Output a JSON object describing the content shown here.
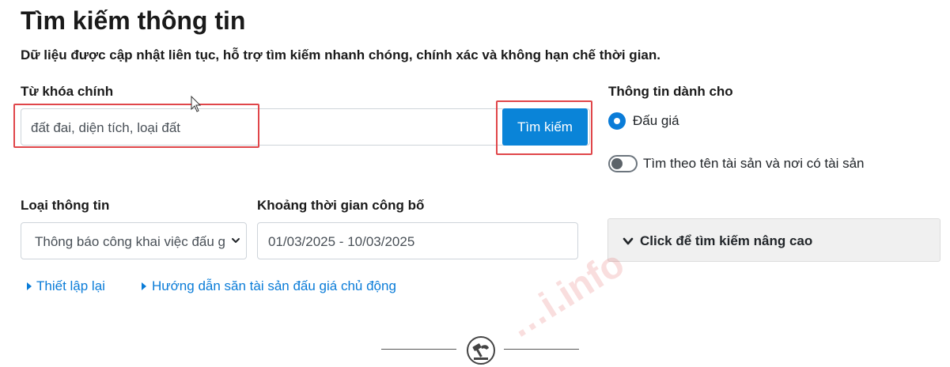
{
  "header": {
    "title": "Tìm kiếm thông tin",
    "subtitle": "Dữ liệu được cập nhật liên tục, hỗ trợ tìm kiếm nhanh chóng, chính xác và không hạn chế thời gian."
  },
  "search": {
    "label": "Từ khóa chính",
    "placeholder": "đất đai, diện tích, loại đất",
    "button_label": "Tìm kiếm"
  },
  "audience": {
    "label": "Thông tin dành cho",
    "radio_label": "Đấu giá",
    "radio_selected": true,
    "toggle_label": "Tìm theo tên tài sản và nơi có tài sản",
    "toggle_on": false
  },
  "info_type": {
    "label": "Loại thông tin",
    "selected": "Thông báo công khai việc đấu giá"
  },
  "date_range": {
    "label": "Khoảng thời gian công bố",
    "value": "01/03/2025 - 10/03/2025"
  },
  "advanced": {
    "label": "Click để tìm kiếm nâng cao"
  },
  "links": {
    "reset": "Thiết lập lại",
    "guide": "Hướng dẫn săn tài sản đấu giá chủ động"
  },
  "footer": {
    "watermark": "…i.info"
  },
  "colors": {
    "accent": "#0a84d8",
    "link": "#0a7cd8",
    "highlight": "#e0464a"
  },
  "icons": {
    "radio": "radio-checked-icon",
    "toggle": "toggle-off-icon",
    "select_chevron": "chevron-down-icon",
    "advanced_chevron": "chevron-down-icon",
    "link_caret": "caret-right-icon",
    "logo": "auction-gavel-icon",
    "cursor": "mouse-cursor-icon"
  }
}
